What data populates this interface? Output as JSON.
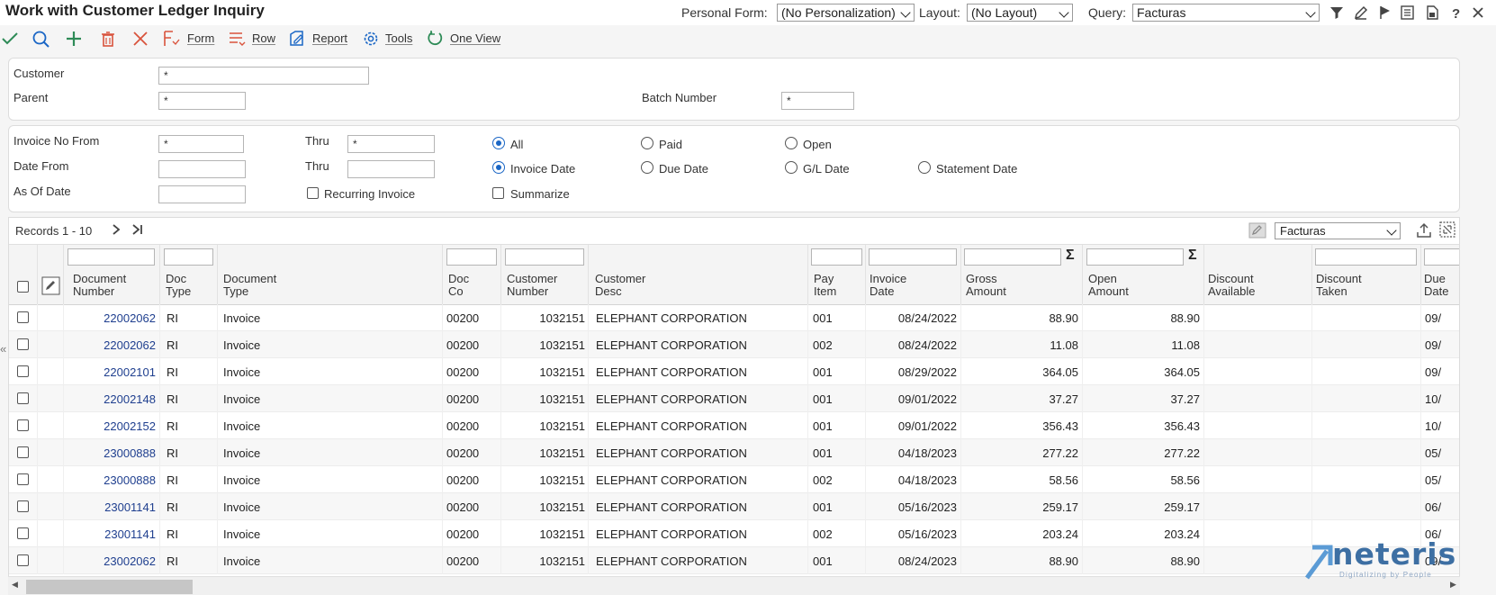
{
  "app": {
    "title": "Work with Customer Ledger Inquiry"
  },
  "header": {
    "personal_form_label": "Personal Form:",
    "personal_form_value": "(No Personalization)",
    "layout_label": "Layout:",
    "layout_value": "(No Layout)",
    "query_label": "Query:",
    "query_value": "Facturas"
  },
  "toolbar": {
    "form_label": "Form",
    "row_label": "Row",
    "report_label": "Report",
    "tools_label": "Tools",
    "one_view_label": "One View"
  },
  "search": {
    "customer_label": "Customer",
    "customer_value": "*",
    "parent_label": "Parent",
    "parent_value": "*",
    "batch_label": "Batch Number",
    "batch_value": "*"
  },
  "filters": {
    "invoice_from_label": "Invoice No From",
    "invoice_from_value": "*",
    "thru_label": "Thru",
    "invoice_thru_value": "*",
    "date_from_label": "Date From",
    "date_thru_label": "Thru",
    "as_of_label": "As Of Date",
    "recurring_label": "Recurring Invoice",
    "summarize_label": "Summarize",
    "status_all": "All",
    "status_paid": "Paid",
    "status_open": "Open",
    "date_invoice": "Invoice Date",
    "date_due": "Due Date",
    "date_gl": "G/L Date",
    "date_statement": "Statement Date"
  },
  "grid": {
    "records_label": "Records 1 - 10",
    "query_value": "Facturas",
    "columns": {
      "doc_number_1": "Document",
      "doc_number_2": "Number",
      "doc_type_1": "Doc",
      "doc_type_2": "Type",
      "doc_type_desc_1": "Document",
      "doc_type_desc_2": "Type",
      "doc_co_1": "Doc",
      "doc_co_2": "Co",
      "cust_num_1": "Customer",
      "cust_num_2": "Number",
      "cust_desc_1": "Customer",
      "cust_desc_2": "Desc",
      "pay_item_1": "Pay",
      "pay_item_2": "Item",
      "inv_date_1": "Invoice",
      "inv_date_2": "Date",
      "gross_1": "Gross",
      "gross_2": "Amount",
      "open_1": "Open",
      "open_2": "Amount",
      "disc_avail_1": "Discount",
      "disc_avail_2": "Available",
      "disc_taken_1": "Discount",
      "disc_taken_2": "Taken",
      "due_1": "Due",
      "due_2": "Date"
    },
    "rows": [
      {
        "doc_number": "22002062",
        "doc_type": "RI",
        "doc_type_desc": "Invoice",
        "doc_co": "00200",
        "cust_num": "1032151",
        "cust_desc": "ELEPHANT CORPORATION",
        "pay_item": "001",
        "inv_date": "08/24/2022",
        "gross": "88.90",
        "open": "88.90",
        "due": "09/"
      },
      {
        "doc_number": "22002062",
        "doc_type": "RI",
        "doc_type_desc": "Invoice",
        "doc_co": "00200",
        "cust_num": "1032151",
        "cust_desc": "ELEPHANT CORPORATION",
        "pay_item": "002",
        "inv_date": "08/24/2022",
        "gross": "11.08",
        "open": "11.08",
        "due": "09/"
      },
      {
        "doc_number": "22002101",
        "doc_type": "RI",
        "doc_type_desc": "Invoice",
        "doc_co": "00200",
        "cust_num": "1032151",
        "cust_desc": "ELEPHANT CORPORATION",
        "pay_item": "001",
        "inv_date": "08/29/2022",
        "gross": "364.05",
        "open": "364.05",
        "due": "09/"
      },
      {
        "doc_number": "22002148",
        "doc_type": "RI",
        "doc_type_desc": "Invoice",
        "doc_co": "00200",
        "cust_num": "1032151",
        "cust_desc": "ELEPHANT CORPORATION",
        "pay_item": "001",
        "inv_date": "09/01/2022",
        "gross": "37.27",
        "open": "37.27",
        "due": "10/"
      },
      {
        "doc_number": "22002152",
        "doc_type": "RI",
        "doc_type_desc": "Invoice",
        "doc_co": "00200",
        "cust_num": "1032151",
        "cust_desc": "ELEPHANT CORPORATION",
        "pay_item": "001",
        "inv_date": "09/01/2022",
        "gross": "356.43",
        "open": "356.43",
        "due": "10/"
      },
      {
        "doc_number": "23000888",
        "doc_type": "RI",
        "doc_type_desc": "Invoice",
        "doc_co": "00200",
        "cust_num": "1032151",
        "cust_desc": "ELEPHANT CORPORATION",
        "pay_item": "001",
        "inv_date": "04/18/2023",
        "gross": "277.22",
        "open": "277.22",
        "due": "05/"
      },
      {
        "doc_number": "23000888",
        "doc_type": "RI",
        "doc_type_desc": "Invoice",
        "doc_co": "00200",
        "cust_num": "1032151",
        "cust_desc": "ELEPHANT CORPORATION",
        "pay_item": "002",
        "inv_date": "04/18/2023",
        "gross": "58.56",
        "open": "58.56",
        "due": "05/"
      },
      {
        "doc_number": "23001141",
        "doc_type": "RI",
        "doc_type_desc": "Invoice",
        "doc_co": "00200",
        "cust_num": "1032151",
        "cust_desc": "ELEPHANT CORPORATION",
        "pay_item": "001",
        "inv_date": "05/16/2023",
        "gross": "259.17",
        "open": "259.17",
        "due": "06/"
      },
      {
        "doc_number": "23001141",
        "doc_type": "RI",
        "doc_type_desc": "Invoice",
        "doc_co": "00200",
        "cust_num": "1032151",
        "cust_desc": "ELEPHANT CORPORATION",
        "pay_item": "002",
        "inv_date": "05/16/2023",
        "gross": "203.24",
        "open": "203.24",
        "due": "06/"
      },
      {
        "doc_number": "23002062",
        "doc_type": "RI",
        "doc_type_desc": "Invoice",
        "doc_co": "00200",
        "cust_num": "1032151",
        "cust_desc": "ELEPHANT CORPORATION",
        "pay_item": "001",
        "inv_date": "08/24/2023",
        "gross": "88.90",
        "open": "88.90",
        "due": "09/"
      }
    ]
  },
  "watermark": {
    "brand": "neteris",
    "tagline": "Digitalizing by People"
  },
  "colors": {
    "accent": "#1a66c5",
    "link": "#1f3f8f",
    "add_icon": "#2e8b57",
    "delete_icon": "#d9533c",
    "logo": "#3d6fa3"
  }
}
